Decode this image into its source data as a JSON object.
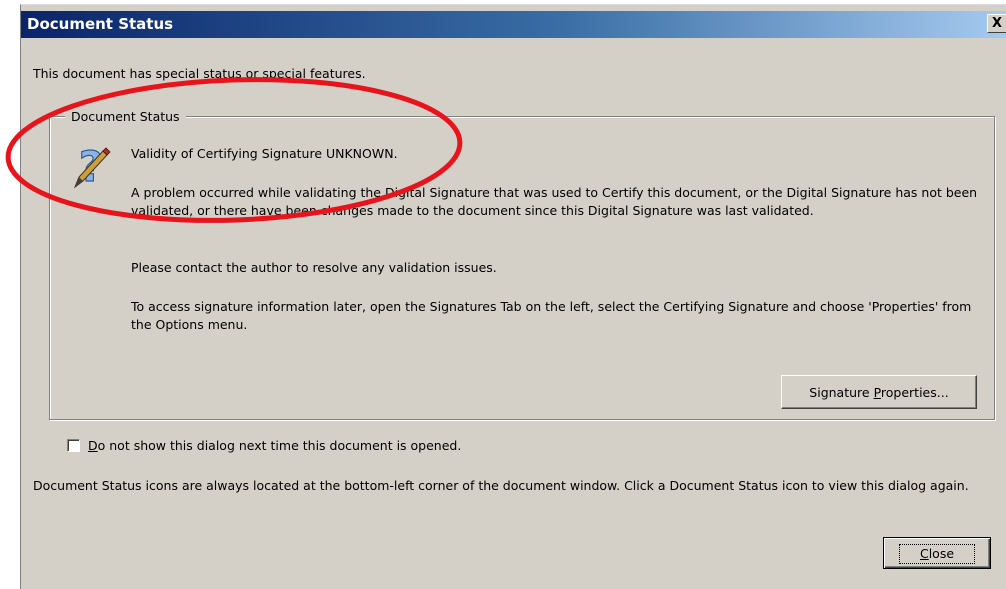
{
  "window": {
    "title": "Document Status",
    "close_glyph": "X"
  },
  "intro": "This document has special status or special features.",
  "group": {
    "legend": "Document Status",
    "icon": "signature-pen-question-icon",
    "heading": "Validity of Certifying Signature UNKNOWN.",
    "paragraph1": "A problem occurred while validating the Digital Signature that was used to Certify this document, or the Digital Signature has not been validated, or there have been changes made to the document since this Digital Signature was last validated.",
    "paragraph2": "Please contact the author to resolve any validation issues.",
    "paragraph3": "To access signature information later, open the Signatures Tab on the left, select the Certifying Signature and choose 'Properties' from the Options menu.",
    "button": {
      "before": "Signature ",
      "mnemonic": "P",
      "after": "roperties..."
    }
  },
  "checkbox": {
    "checked": false,
    "mnemonic": "D",
    "label_rest": "o not show this dialog next time this document is opened."
  },
  "footer": "Document Status icons are always located at the bottom-left corner of the document window. Click a Document Status icon to view this dialog again.",
  "close_button": {
    "mnemonic": "C",
    "rest": "lose"
  },
  "colors": {
    "dialog_bg": "#d4d0c8",
    "title_gradient_start": "#0a246a",
    "title_gradient_end": "#a6caf0",
    "annotation_ellipse": "#e8141c"
  }
}
